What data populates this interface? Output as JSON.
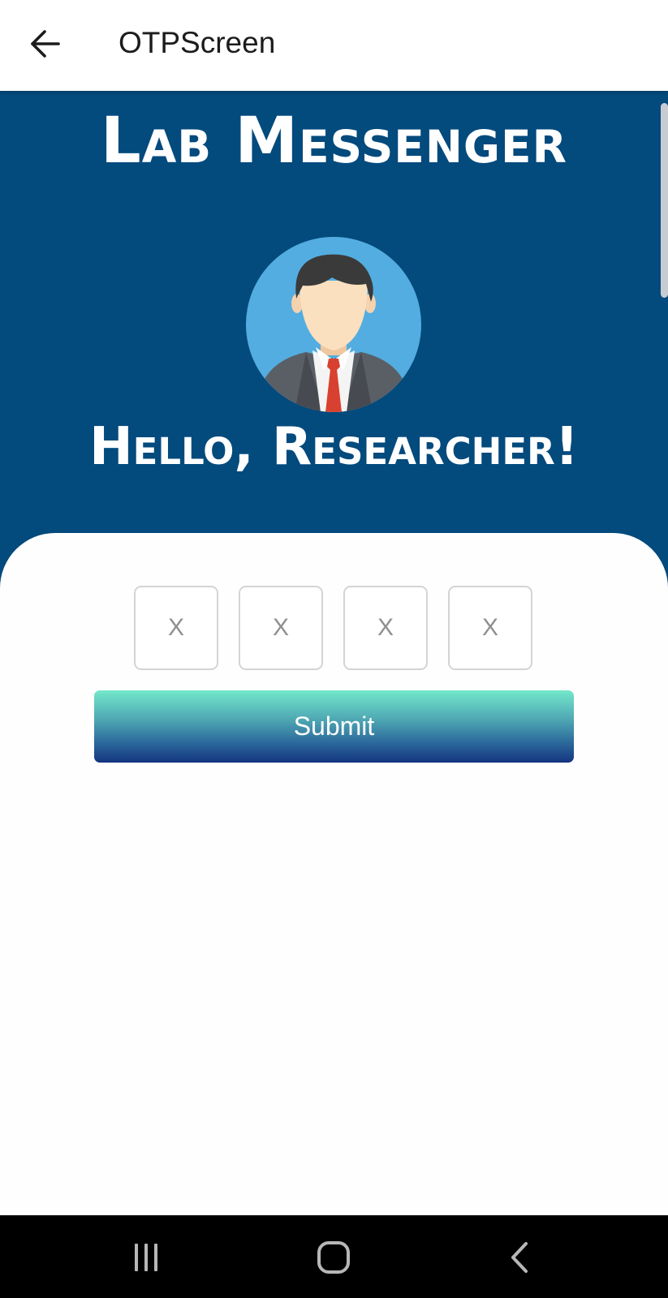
{
  "app_bar": {
    "title": "OTPScreen",
    "back_icon": "arrow-left-icon"
  },
  "header": {
    "brand_title": "Lab Messenger",
    "avatar_icon": "businessman-avatar",
    "greeting": "Hello, Researcher!",
    "background_color": "#034a7d"
  },
  "otp": {
    "fields": [
      {
        "value": "",
        "placeholder": "X"
      },
      {
        "value": "",
        "placeholder": "X"
      },
      {
        "value": "",
        "placeholder": "X"
      },
      {
        "value": "",
        "placeholder": "X"
      }
    ]
  },
  "submit": {
    "label": "Submit",
    "gradient_top": "#74e8cb",
    "gradient_bottom": "#14347f"
  },
  "nav_bar": {
    "buttons": [
      "recent-apps-icon",
      "home-icon",
      "back-chevron-icon"
    ]
  }
}
